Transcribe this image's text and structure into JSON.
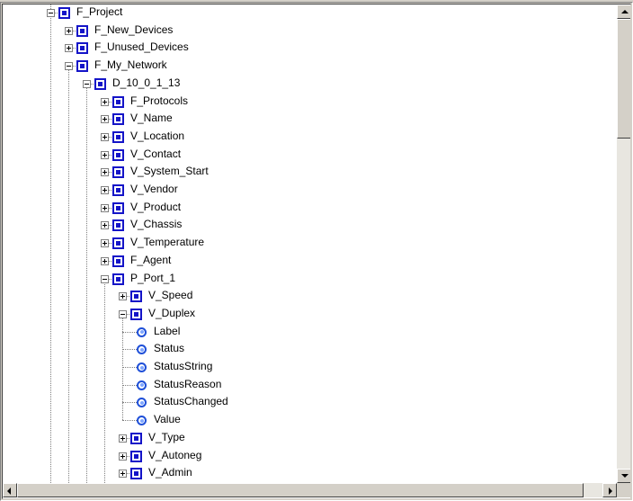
{
  "tree": {
    "root": {
      "label": "F_Project"
    },
    "project_children": [
      {
        "label": "F_New_Devices"
      },
      {
        "label": "F_Unused_Devices"
      },
      {
        "label": "F_My_Network"
      }
    ],
    "device": {
      "label": "D_10_0_1_13"
    },
    "device_children": [
      {
        "label": "F_Protocols"
      },
      {
        "label": "V_Name"
      },
      {
        "label": "V_Location"
      },
      {
        "label": "V_Contact"
      },
      {
        "label": "V_System_Start"
      },
      {
        "label": "V_Vendor"
      },
      {
        "label": "V_Product"
      },
      {
        "label": "V_Chassis"
      },
      {
        "label": "V_Temperature"
      },
      {
        "label": "F_Agent"
      },
      {
        "label": "P_Port_1"
      }
    ],
    "port_children": [
      {
        "label": "V_Speed"
      },
      {
        "label": "V_Duplex"
      },
      {
        "label": "V_Type"
      },
      {
        "label": "V_Autoneg"
      },
      {
        "label": "V_Admin"
      }
    ],
    "duplex_children": [
      {
        "label": "Label"
      },
      {
        "label": "Status"
      },
      {
        "label": "StatusString"
      },
      {
        "label": "StatusReason"
      },
      {
        "label": "StatusChanged"
      },
      {
        "label": "Value"
      }
    ]
  }
}
